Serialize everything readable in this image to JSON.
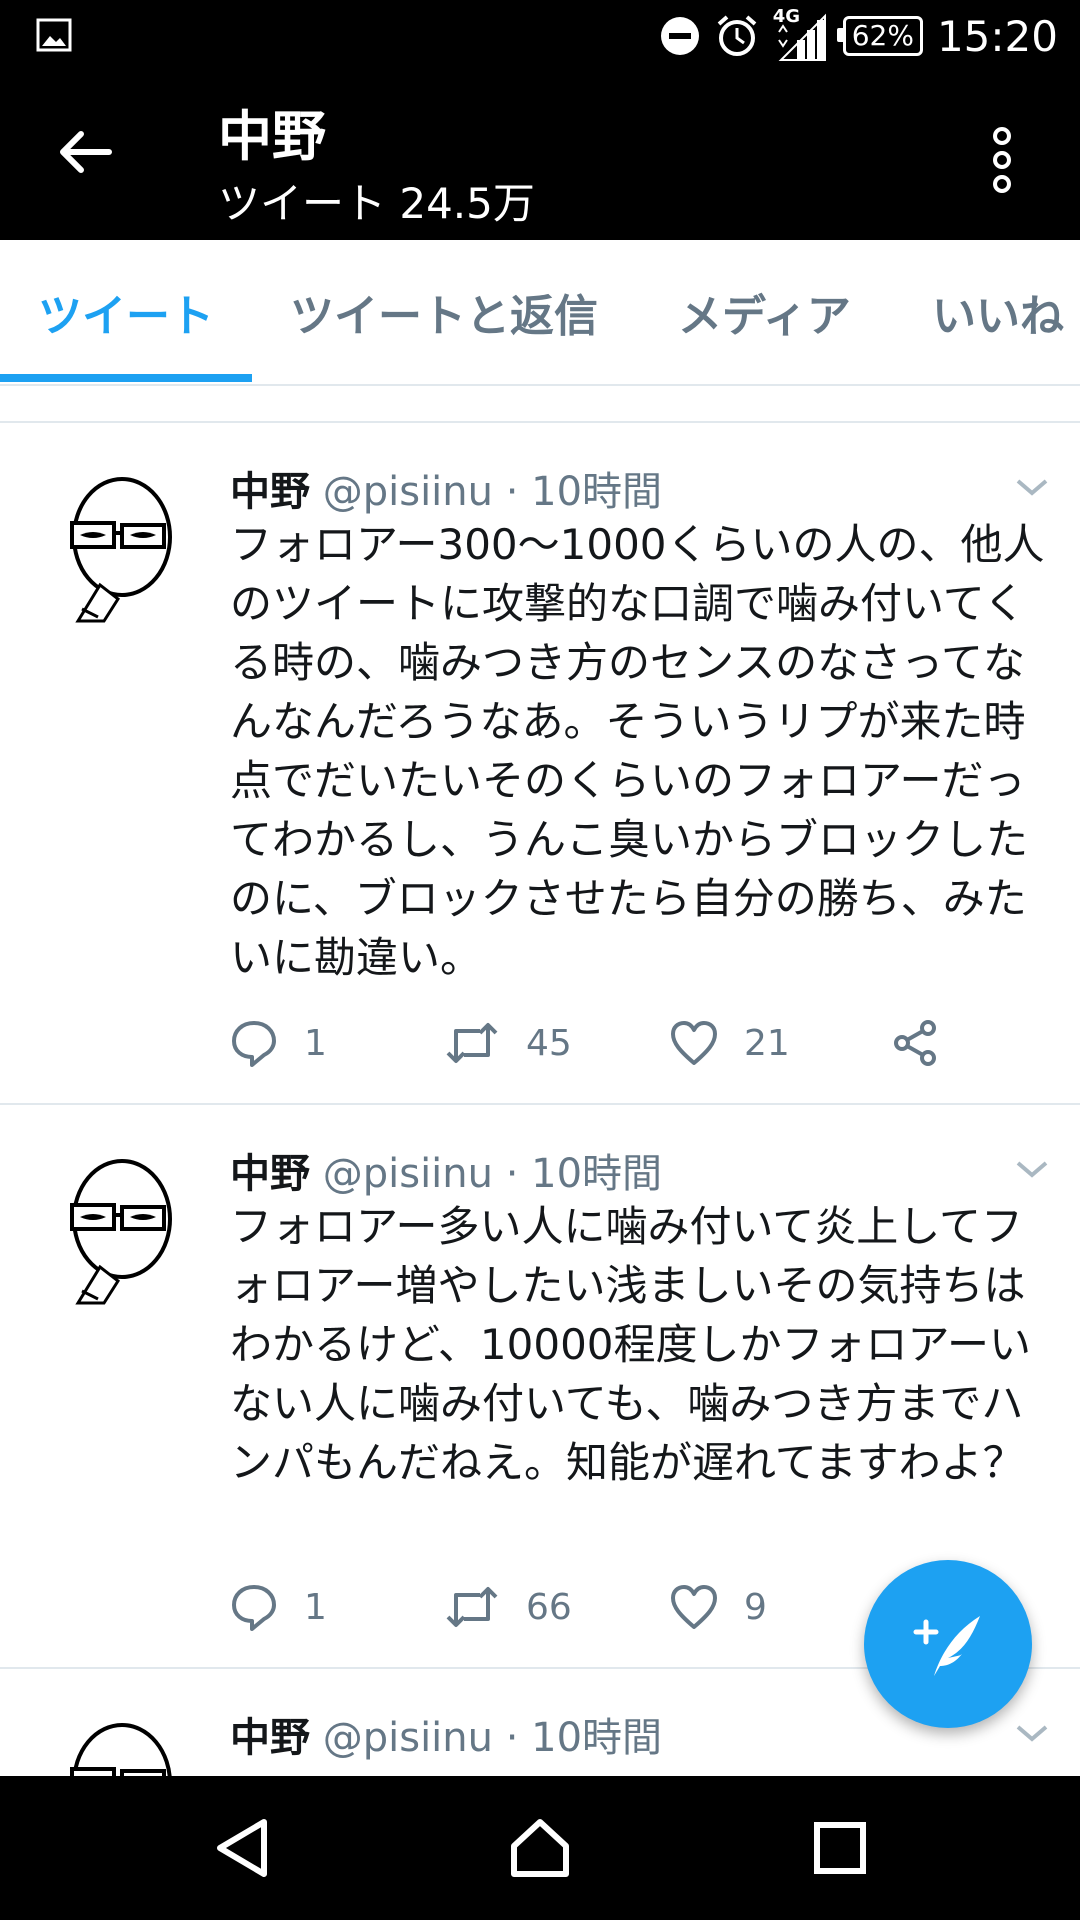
{
  "status_bar": {
    "time": "15:20",
    "battery": "62%",
    "network": "4G",
    "icons": [
      "gallery-icon",
      "do-not-disturb-icon",
      "alarm-icon",
      "signal-icon",
      "battery-icon"
    ]
  },
  "header": {
    "title": "中野",
    "subtitle": "ツイート 24.5万",
    "icons": [
      "back-arrow-icon",
      "more-vertical-icon"
    ]
  },
  "tabs": [
    {
      "label": "ツイート",
      "active": true
    },
    {
      "label": "ツイートと返信",
      "active": false
    },
    {
      "label": "メディア",
      "active": false
    },
    {
      "label": "いいね",
      "active": false
    }
  ],
  "tweets": [
    {
      "name": "中野",
      "meta": "@pisiinu · 10時間",
      "text": "フォロアー300〜1000くらいの人の、他人のツイートに攻撃的な口調で噛み付いてくる時の、噛みつき方のセンスのなさってなんなんだろうなあ。そういうリプが来た時点でだいたいそのくらいのフォロアーだってわかるし、うんこ臭いからブロックしたのに、ブロックさせたら自分の勝ち、みたいに勘違い。",
      "replies": "1",
      "retweets": "45",
      "likes": "21"
    },
    {
      "name": "中野",
      "meta": "@pisiinu · 10時間",
      "text": "フォロアー多い人に噛み付いて炎上してフォロアー増やしたい浅ましいその気持ちはわかるけど、10000程度しかフォロアーいない人に噛み付いても、噛みつき方までハンパもんだねえ。知能が遅れてますわよ？",
      "replies": "1",
      "retweets": "66",
      "likes": "9"
    },
    {
      "name": "中野",
      "meta": "@pisiinu · 10時間"
    }
  ],
  "colors": {
    "accent": "#1da1f2",
    "secondary_text": "#657786",
    "primary_text": "#14171a"
  },
  "fab": {
    "icon": "compose-tweet-icon"
  },
  "nav_bar": {
    "icons": [
      "back-triangle-icon",
      "home-icon",
      "recents-icon"
    ]
  }
}
